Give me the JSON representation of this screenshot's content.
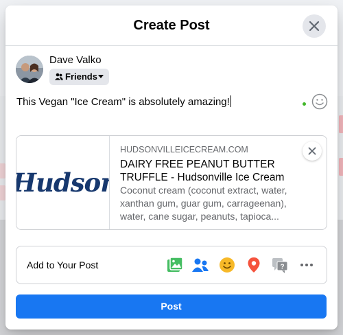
{
  "modal": {
    "title": "Create Post"
  },
  "user": {
    "name": "Dave Valko",
    "audience": "Friends"
  },
  "composer": {
    "text": "This Vegan \"Ice Cream\" is absolutely amazing!"
  },
  "link_preview": {
    "domain": "HUDSONVILLEICECREAM.COM",
    "title": "DAIRY FREE PEANUT BUTTER TRUFFLE - Hudsonville Ice Cream",
    "description": "Coconut cream (coconut extract, water, xanthan gum, guar gum, carrageenan), water, cane sugar, peanuts, tapioca...",
    "image_brand_text": "Hudsonville"
  },
  "add_to_post": {
    "label": "Add to Your Post",
    "tools": [
      {
        "name": "photo-video-icon",
        "color": "#45bd62"
      },
      {
        "name": "tag-people-icon",
        "color": "#1877f2"
      },
      {
        "name": "feeling-icon",
        "color": "#f7b928"
      },
      {
        "name": "check-in-icon",
        "color": "#f5533d"
      },
      {
        "name": "ask-question-icon",
        "color": "#bcc0c4"
      },
      {
        "name": "more-options-icon",
        "color": "#65676b"
      }
    ]
  },
  "actions": {
    "post_label": "Post"
  },
  "colors": {
    "primary": "#1877f2",
    "secondary_text": "#65676b",
    "divider": "#dadde1"
  }
}
